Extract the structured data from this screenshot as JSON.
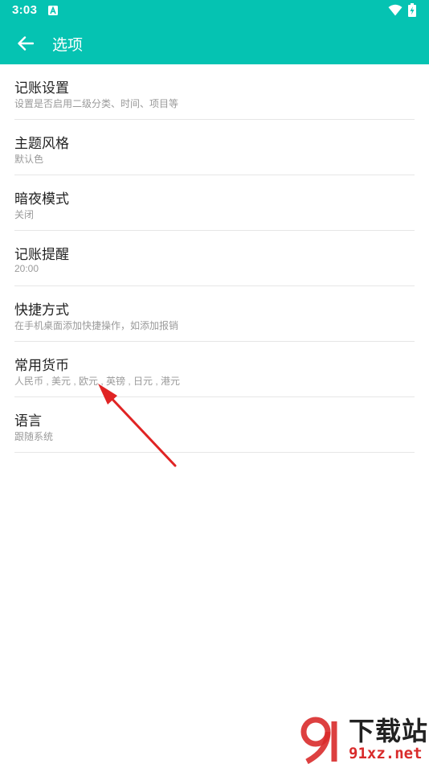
{
  "status_bar": {
    "time": "3:03",
    "icons": [
      "a-notification-icon",
      "wifi-icon",
      "battery-charging-icon"
    ]
  },
  "app_bar": {
    "back_icon": "arrow-left-icon",
    "title": "选项"
  },
  "settings": {
    "items": [
      {
        "title": "记账设置",
        "subtitle": "设置是否启用二级分类、时间、项目等"
      },
      {
        "title": "主题风格",
        "subtitle": "默认色"
      },
      {
        "title": "暗夜模式",
        "subtitle": "关闭"
      },
      {
        "title": "记账提醒",
        "subtitle": "20:00"
      },
      {
        "title": "快捷方式",
        "subtitle": "在手机桌面添加快捷操作，如添加报销"
      },
      {
        "title": "常用货币",
        "subtitle": "人民币 , 美元 , 欧元 , 英镑 , 日元 , 港元"
      },
      {
        "title": "语言",
        "subtitle": "跟随系统"
      }
    ]
  },
  "watermark": {
    "text_cn": "下载站",
    "url": "91xz.net"
  },
  "colors": {
    "primary": "#05c3b2",
    "arrow": "#e02424",
    "watermark_red": "#d92b2b"
  }
}
